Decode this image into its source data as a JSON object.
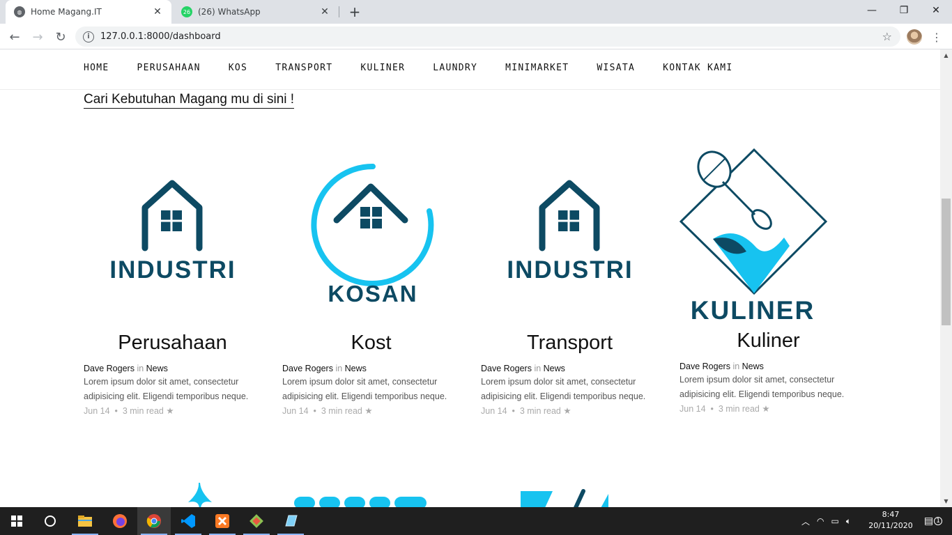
{
  "browser": {
    "tabs": [
      {
        "title": "Home Magang.IT",
        "active": true
      },
      {
        "title": "(26) WhatsApp",
        "active": false,
        "badge": "26"
      }
    ],
    "url": "127.0.0.1:8000/dashboard"
  },
  "site": {
    "nav": [
      "HOME",
      "PERUSAHAAN",
      "KOS",
      "TRANSPORT",
      "KULINER",
      "LAUNDRY",
      "MINIMARKET",
      "WISATA",
      "KONTAK KAMI"
    ],
    "headline": "Cari Kebutuhan Magang mu di sini !",
    "cards": [
      {
        "logo_text": "INDUSTRI",
        "title": "Perusahaan",
        "author": "Dave Rogers",
        "in": "in",
        "category": "News",
        "excerpt": "Lorem ipsum dolor sit amet, consectetur adipisicing elit. Eligendi temporibus neque.",
        "date": "Jun 14",
        "read": "3 min read"
      },
      {
        "logo_text": "KOSAN",
        "title": "Kost",
        "author": "Dave Rogers",
        "in": "in",
        "category": "News",
        "excerpt": "Lorem ipsum dolor sit amet, consectetur adipisicing elit. Eligendi temporibus neque.",
        "date": "Jun 14",
        "read": "3 min read"
      },
      {
        "logo_text": "INDUSTRI",
        "title": "Transport",
        "author": "Dave Rogers",
        "in": "in",
        "category": "News",
        "excerpt": "Lorem ipsum dolor sit amet, consectetur adipisicing elit. Eligendi temporibus neque.",
        "date": "Jun 14",
        "read": "3 min read"
      },
      {
        "logo_text": "KULINER",
        "title": "Kuliner",
        "author": "Dave Rogers",
        "in": "in",
        "category": "News",
        "excerpt": "Lorem ipsum dolor sit amet, consectetur adipisicing elit. Eligendi temporibus neque.",
        "date": "Jun 14",
        "read": "3 min read"
      }
    ],
    "colors": {
      "dark_teal": "#0d4a63",
      "cyan": "#17c3f0"
    }
  },
  "taskbar": {
    "time": "8:47",
    "date": "20/11/2020",
    "notification_count": "1",
    "apps": [
      "windows-start-icon",
      "cortana-icon",
      "file-explorer-icon",
      "firefox-icon",
      "chrome-icon",
      "vscode-icon",
      "xampp-icon",
      "git-icon",
      "notepad-icon"
    ]
  }
}
